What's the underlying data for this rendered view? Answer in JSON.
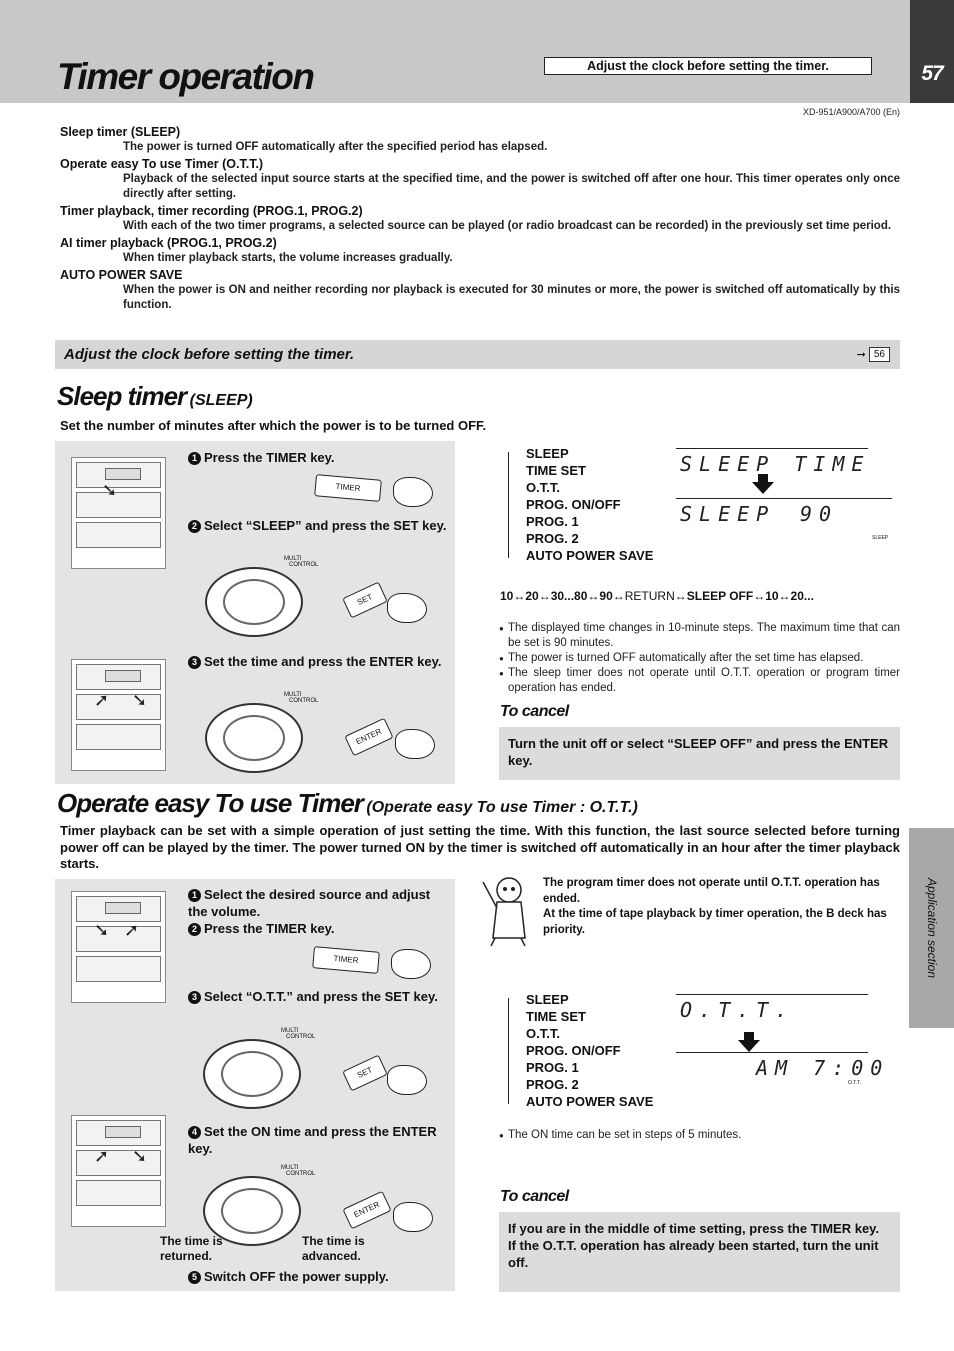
{
  "header": {
    "title": "Timer operation",
    "box_text": "Adjust the clock before setting the timer.",
    "page_number": "57",
    "model_code": "XD-951/A900/A700 (En)"
  },
  "side_tab": {
    "label": "Application section"
  },
  "definitions": [
    {
      "term": "Sleep timer (SLEEP)",
      "desc": "The power is turned OFF automatically after the specified period has elapsed."
    },
    {
      "term": "Operate easy To use Timer (O.T.T.)",
      "desc": "Playback of the selected input source starts at the specified time, and the power is switched off after one hour. This timer operates only once directly after setting."
    },
    {
      "term": "Timer playback, timer recording (PROG.1, PROG.2)",
      "desc": "With each of the two timer programs, a selected source can be played (or radio broadcast can be recorded) in the previously set time period."
    },
    {
      "term": "AI timer playback (PROG.1, PROG.2)",
      "desc": "When timer playback starts, the volume increases gradually."
    },
    {
      "term": "AUTO POWER SAVE",
      "desc": "When the power is ON and neither recording nor playback is executed for 30 minutes or more, the power is switched off automatically by this function."
    }
  ],
  "clock_band": {
    "text": "Adjust the clock before setting the timer.",
    "ref_page": "56",
    "ref_arrow": "➞"
  },
  "sleep": {
    "title": "Sleep timer",
    "subtitle": "(SLEEP)",
    "lead": "Set the number of minutes after which the power is to be turned OFF.",
    "steps": [
      {
        "num": "1",
        "text": "Press the TIMER key."
      },
      {
        "num": "2",
        "text": "Select “SLEEP” and press the SET key."
      },
      {
        "num": "3",
        "text": "Set the time and press the ENTER key."
      }
    ],
    "keys": {
      "timer": "TIMER",
      "set": "SET",
      "enter": "ENTER",
      "multi": "MULTI",
      "control": "CONTROL"
    },
    "menu": [
      "SLEEP",
      "TIME SET",
      "O.T.T.",
      "PROG. ON/OFF",
      "PROG. 1",
      "PROG. 2",
      "AUTO POWER SAVE"
    ],
    "lcd_top": "SLEEP TIME",
    "lcd_bottom": "SLEEP",
    "lcd_value": "90",
    "indicator": "SLEEP",
    "sequence": {
      "part1": "10↔20↔30...80↔90↔",
      "return": "RETURN",
      "part2": "↔SLEEP OFF↔10↔20..."
    },
    "notes": [
      "The displayed time changes in 10-minute steps. The maximum time that can be set is 90 minutes.",
      "The power is turned OFF automatically after the set time has elapsed.",
      "The sleep timer does not operate until O.T.T. operation or program timer operation has ended."
    ],
    "cancel_title": "To cancel",
    "cancel_text": "Turn the unit off or select “SLEEP OFF” and press the ENTER key."
  },
  "ott": {
    "title": "Operate easy To use Timer",
    "subtitle": "(Operate easy To use Timer : O.T.T.)",
    "lead": "Timer playback can be set with a simple operation of just setting the time. With this function, the last source selected before turning power off can be played by the timer. The power turned ON by the timer is switched off automatically in an hour after the timer playback starts.",
    "steps": [
      {
        "num": "1",
        "text": "Select the desired source and adjust the volume."
      },
      {
        "num": "2",
        "text": "Press the TIMER key."
      },
      {
        "num": "3",
        "text": "Select “O.T.T.” and press the SET key."
      },
      {
        "num": "4",
        "text": "Set the ON time and press the ENTER key."
      },
      {
        "num": "5",
        "text": "Switch OFF the power supply."
      }
    ],
    "captions": {
      "returned": "The time is returned.",
      "advanced": "The time is advanced."
    },
    "note_lines": [
      "The program timer does not operate until O.T.T. operation has ended.",
      "At the time of tape playback by timer operation, the B deck has priority."
    ],
    "menu": [
      "SLEEP",
      "TIME SET",
      "O.T.T.",
      "PROG. ON/OFF",
      "PROG. 1",
      "PROG. 2",
      "AUTO POWER SAVE"
    ],
    "lcd_top": "O.T.T.",
    "lcd_bottom": "AM 7:00",
    "indicator": "O.T.T.",
    "notes": [
      "The ON time can be set in steps of 5 minutes."
    ],
    "cancel_title": "To cancel",
    "cancel_lines": [
      "If you are in the middle of time setting, press the TIMER key.",
      "If the O.T.T. operation has already been started, turn the unit off."
    ]
  }
}
